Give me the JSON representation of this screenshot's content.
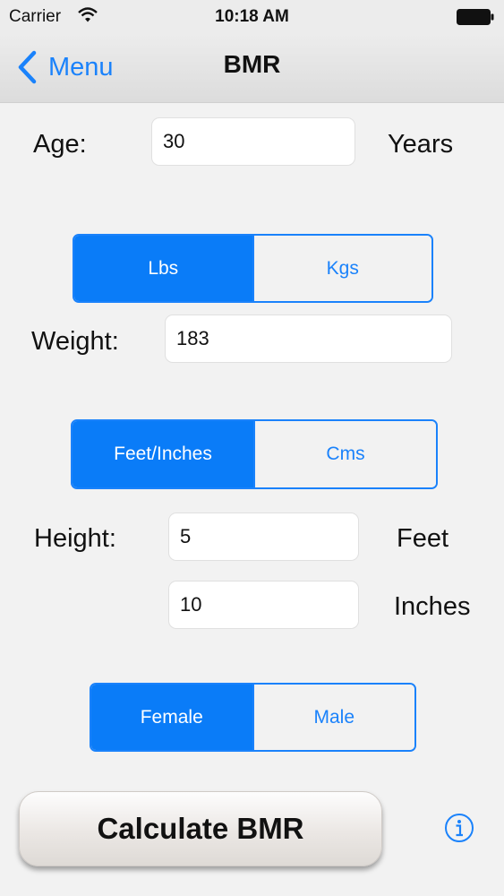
{
  "status": {
    "carrier": "Carrier",
    "time": "10:18 AM"
  },
  "nav": {
    "back_label": "Menu",
    "title": "BMR"
  },
  "age": {
    "label": "Age:",
    "value": "30",
    "unit": "Years"
  },
  "weight_unit": {
    "options": [
      "Lbs",
      "Kgs"
    ],
    "selected": "Lbs"
  },
  "weight": {
    "label": "Weight:",
    "value": "183"
  },
  "height_unit": {
    "options": [
      "Feet/Inches",
      "Cms"
    ],
    "selected": "Feet/Inches"
  },
  "height": {
    "label": "Height:",
    "feet_value": "5",
    "feet_unit": "Feet",
    "inches_value": "10",
    "inches_unit": "Inches"
  },
  "gender": {
    "options": [
      "Female",
      "Male"
    ],
    "selected": "Female"
  },
  "calculate": {
    "label": "Calculate BMR"
  },
  "colors": {
    "accent": "#1a82fb",
    "selected_segment": "#0a7cf8",
    "background": "#f2f2f2"
  },
  "icons": {
    "back": "chevron-left-icon",
    "info": "info-icon",
    "wifi": "wifi-icon",
    "battery": "battery-icon"
  }
}
